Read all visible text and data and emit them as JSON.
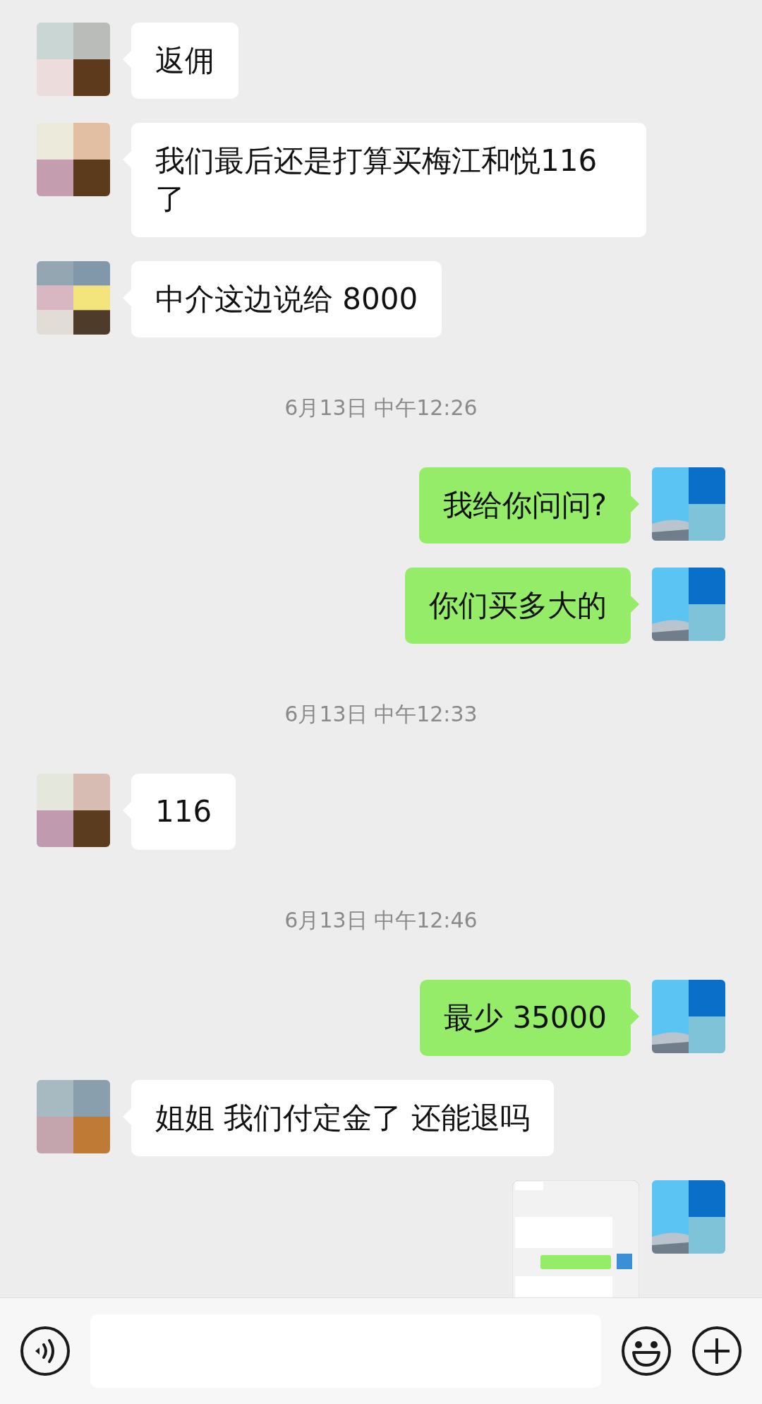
{
  "messages": [
    {
      "kind": "received",
      "text": "返佣"
    },
    {
      "kind": "received",
      "text": "我们最后还是打算买梅江和悦116了"
    },
    {
      "kind": "received",
      "text": "中介这边说给 8000"
    },
    {
      "kind": "time",
      "text": "6月13日 中午12:26"
    },
    {
      "kind": "sent",
      "text": "我给你问问?"
    },
    {
      "kind": "sent",
      "text": "你们买多大的"
    },
    {
      "kind": "time",
      "text": "6月13日 中午12:33"
    },
    {
      "kind": "received",
      "text": "116"
    },
    {
      "kind": "time",
      "text": "6月13日 中午12:46"
    },
    {
      "kind": "sent",
      "text": "最少 35000"
    },
    {
      "kind": "received",
      "text": "姐姐 我们付定金了 还能退吗"
    },
    {
      "kind": "sent_image"
    }
  ]
}
